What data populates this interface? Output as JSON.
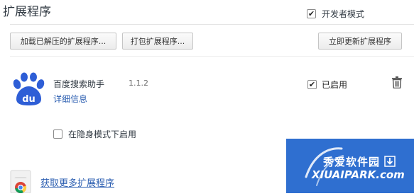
{
  "header": {
    "title": "扩展程序",
    "developer_mode_label": "开发者模式",
    "developer_mode_checked": true
  },
  "toolbar": {
    "load_unpacked_label": "加载已解压的扩展程序...",
    "pack_label": "打包扩展程序...",
    "update_now_label": "立即更新扩展程序"
  },
  "extensions": [
    {
      "name": "百度搜索助手",
      "version": "1.1.2",
      "details_link": "详细信息",
      "enabled_label": "已启用",
      "enabled": true,
      "incognito_label": "在隐身模式下启用",
      "incognito_checked": false,
      "icon": "baidu-paw-icon"
    }
  ],
  "footer": {
    "get_more_label": "获取更多扩展程序",
    "icon": "chrome-webstore-icon"
  },
  "watermark": {
    "top_text": "秀爱软件园",
    "bottom_text": "XIUAIPARK.com"
  },
  "colors": {
    "link": "#2a5db0",
    "baidu_blue": "#2e5ed6",
    "watermark_bg": "#2f6fd0"
  }
}
